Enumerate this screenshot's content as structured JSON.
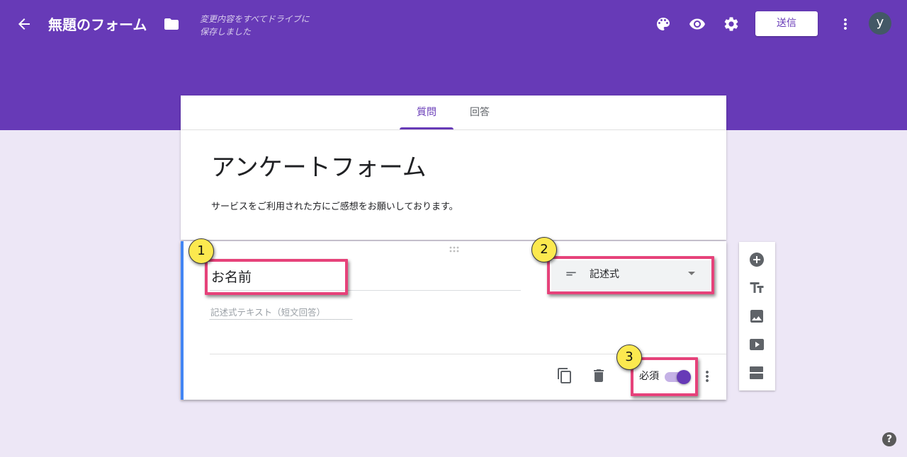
{
  "colors": {
    "brand_purple": "#673ab7",
    "page_background": "#ede7f6",
    "active_question_accent": "#4285f4",
    "annotation_box": "#e6427a",
    "annotation_marker": "#fce94f",
    "toggle_track": "#c5b2e6"
  },
  "header": {
    "back_icon": "back-arrow-icon",
    "title": "無題のフォーム",
    "folder_icon": "folder-icon",
    "save_status": [
      "変更内容をすべてドライブに",
      "保存しました"
    ],
    "action_icons": [
      "palette-icon",
      "preview-eye-icon",
      "settings-gear-icon"
    ],
    "send_label": "送信",
    "more_icon": "more-vert-icon",
    "avatar_initial": "y"
  },
  "tabs": [
    {
      "label": "質問",
      "active": true
    },
    {
      "label": "回答",
      "active": false
    }
  ],
  "form": {
    "title": "アンケートフォーム",
    "description": "サービスをご利用された方にご感想をお願いしております。"
  },
  "question": {
    "drag_handle_icon": "drag-handle-icon",
    "title": "お名前",
    "type": {
      "icon": "short-text-icon",
      "label": "記述式",
      "dropdown_icon": "arrow-drop-down-icon"
    },
    "answer_placeholder": "記述式テキスト（短文回答）",
    "footer": {
      "copy_icon": "copy-icon",
      "delete_icon": "delete-icon",
      "required_label": "必須",
      "required": true,
      "more_icon": "more-vert-icon"
    }
  },
  "annotations": [
    {
      "number": "1"
    },
    {
      "number": "2"
    },
    {
      "number": "3"
    }
  ],
  "side_toolbar": {
    "icons": [
      "add-circle-icon",
      "text-fields-icon",
      "image-icon",
      "video-icon",
      "section-icon"
    ]
  },
  "help": {
    "icon": "help-icon",
    "glyph": "?"
  }
}
